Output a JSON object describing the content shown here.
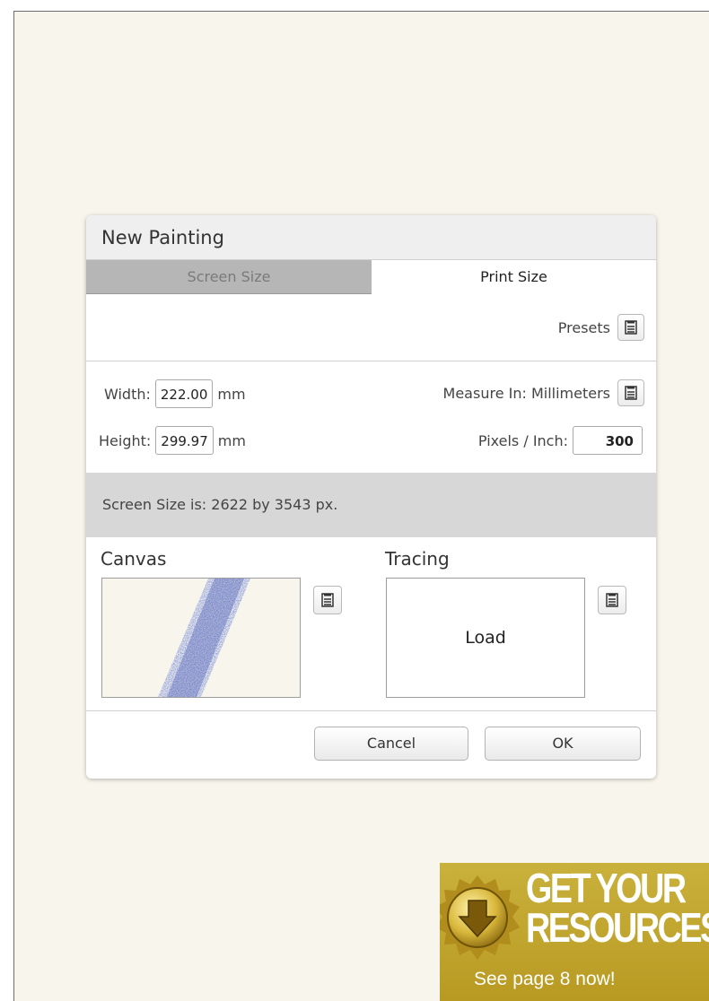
{
  "dialog": {
    "title": "New Painting",
    "tabs": [
      {
        "label": "Screen Size",
        "active": false
      },
      {
        "label": "Print Size",
        "active": true
      }
    ],
    "presets_label": "Presets",
    "width": {
      "label": "Width:",
      "value": "222.00",
      "unit": "mm"
    },
    "height": {
      "label": "Height:",
      "value": "299.97",
      "unit": "mm"
    },
    "measure_label": "Measure In: Millimeters",
    "ppi": {
      "label": "Pixels / Inch:",
      "value": "300"
    },
    "screen_size_text": "Screen Size is: 2622 by 3543 px.",
    "canvas_label": "Canvas",
    "tracing_label": "Tracing",
    "tracing_load": "Load",
    "cancel_label": "Cancel",
    "ok_label": "OK"
  },
  "badge": {
    "line1": "GET YOUR",
    "line2": "RESOURCES",
    "sub": "See page 8 now!"
  },
  "icons": [
    "menu-icon",
    "download-arrow-icon"
  ],
  "colors": {
    "background": "#f7f5ec",
    "inactive_tab": "#b6b6b6",
    "status_bar": "#d7d7d7",
    "badge_gold": "#c0a42e",
    "canvas_stroke": "#4a5bb8"
  }
}
